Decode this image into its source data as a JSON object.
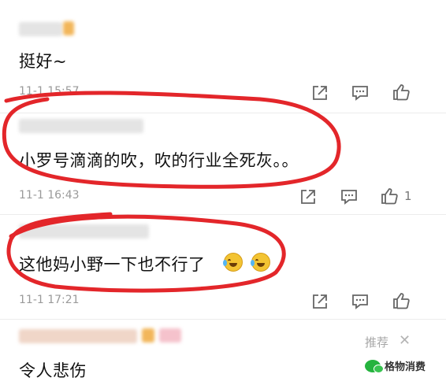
{
  "comments": [
    {
      "text": "挺好~",
      "time": "11-1 15:57",
      "likes": ""
    },
    {
      "text": "小罗号滴滴的吹，吹的行业全死灰。。",
      "time": "11-1 16:43",
      "likes": "1"
    },
    {
      "text": "这他妈小野一下也不行了",
      "time": "11-1 17:21",
      "likes": ""
    },
    {
      "text": "令人悲伤",
      "time": "",
      "likes": ""
    }
  ],
  "recommend": {
    "label": "推荐",
    "close": "✕"
  },
  "watermark": {
    "text": "格物消费"
  },
  "icons": [
    "share-icon",
    "comment-icon",
    "like-icon"
  ],
  "colors": {
    "annotation_red": "#e3262a",
    "time_gray": "#9a9a9a",
    "icon_gray": "#666666"
  }
}
